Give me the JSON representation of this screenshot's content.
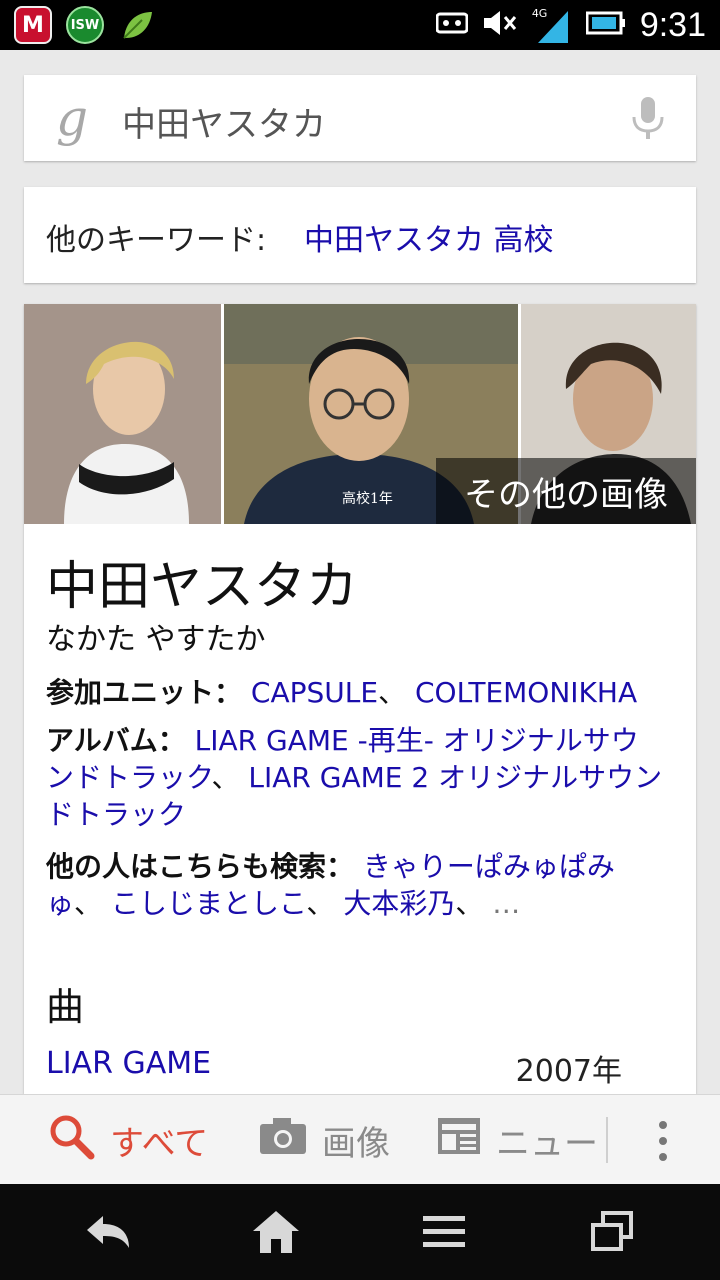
{
  "status_bar": {
    "app_icons": [
      "mcafee-icon",
      "isw-icon",
      "leaf-icon"
    ],
    "isw_label": "ISW",
    "mcafee_label": "M",
    "network": "4G",
    "time": "9:31"
  },
  "search": {
    "query": "中田ヤスタカ",
    "logo": "g"
  },
  "related": {
    "label": "他のキーワード:",
    "link": "中田ヤスタカ 高校"
  },
  "knowledge_panel": {
    "photos": [
      "photo-1",
      "photo-2",
      "photo-3"
    ],
    "photo2_caption": "高校1年",
    "more_images": "その他の画像",
    "title": "中田ヤスタカ",
    "reading": "なかた やすたか",
    "facts": {
      "units_label": "参加ユニット：",
      "units": [
        "CAPSULE",
        "COLTEMONIKHA"
      ],
      "albums_label": "アルバム：",
      "albums": [
        "LIAR GAME -再生- オリジナルサウンドトラック",
        "LIAR GAME 2 オリジナルサウンドトラック"
      ],
      "others_label": "他の人はこちらも検索：",
      "others": [
        "きゃりーぱみゅぱみゅ",
        "こしじまとしこ",
        "大本彩乃"
      ],
      "others_more": "…",
      "separator": "、"
    },
    "songs_title": "曲",
    "songs": [
      {
        "name": "LIAR GAME",
        "year": "2007年"
      }
    ]
  },
  "tabs": {
    "all": "すべて",
    "images": "画像",
    "news": "ニュー"
  },
  "colors": {
    "link": "#1a0dab",
    "active_tab": "#dd4b39"
  }
}
